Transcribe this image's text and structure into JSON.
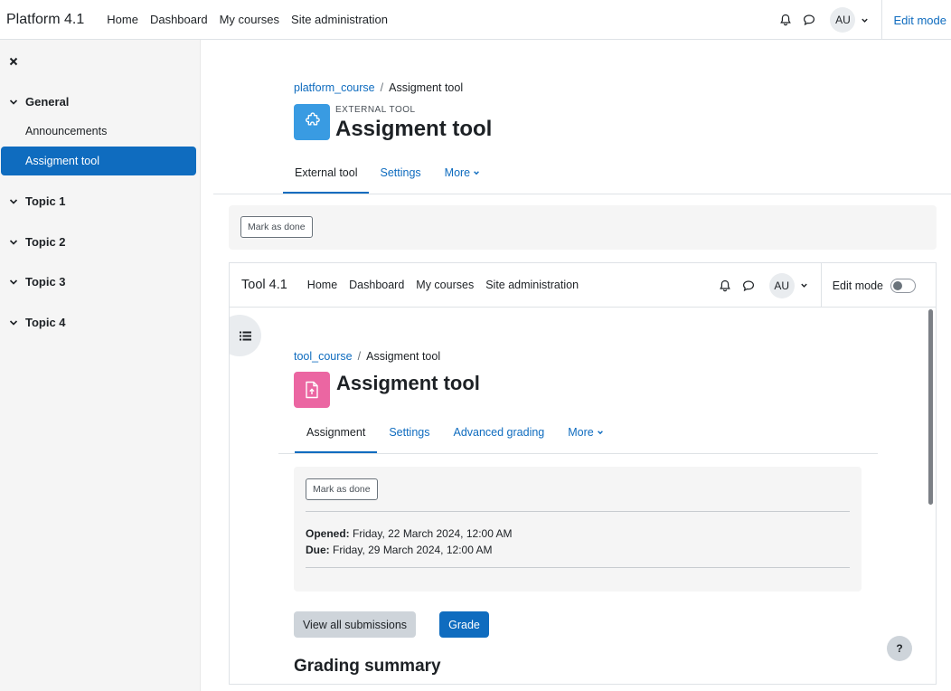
{
  "navbar": {
    "brand": "Platform 4.1",
    "links": [
      "Home",
      "Dashboard",
      "My courses",
      "Site administration"
    ],
    "avatar": "AU",
    "edit_mode": "Edit mode"
  },
  "drawer": {
    "sections": [
      {
        "title": "General",
        "activities": [
          "Announcements",
          "Assigment tool"
        ]
      },
      {
        "title": "Topic 1"
      },
      {
        "title": "Topic 2"
      },
      {
        "title": "Topic 3"
      },
      {
        "title": "Topic 4"
      }
    ],
    "active_activity": "Assigment tool"
  },
  "page": {
    "breadcrumb": [
      "platform_course",
      "Assigment tool"
    ],
    "pretitle": "EXTERNAL TOOL",
    "title": "Assigment tool",
    "tabs": [
      "External tool",
      "Settings",
      "More"
    ],
    "mark_done": "Mark as done"
  },
  "tool": {
    "navbar": {
      "brand": "Tool 4.1",
      "links": [
        "Home",
        "Dashboard",
        "My courses",
        "Site administration"
      ],
      "avatar": "AU",
      "edit_mode": "Edit mode"
    },
    "breadcrumb": [
      "tool_course",
      "Assigment tool"
    ],
    "title": "Assigment tool",
    "tabs": [
      "Assignment",
      "Settings",
      "Advanced grading",
      "More"
    ],
    "mark_done": "Mark as done",
    "opened_label": "Opened:",
    "opened_value": "Friday, 22 March 2024, 12:00 AM",
    "due_label": "Due:",
    "due_value": "Friday, 29 March 2024, 12:00 AM",
    "view_submissions": "View all submissions",
    "grade": "Grade",
    "grading_summary": "Grading summary",
    "help": "?"
  },
  "colors": {
    "primary": "#0f6cbf",
    "external_tool_icon": "#399be2",
    "assignment_icon": "#eb66a2"
  }
}
